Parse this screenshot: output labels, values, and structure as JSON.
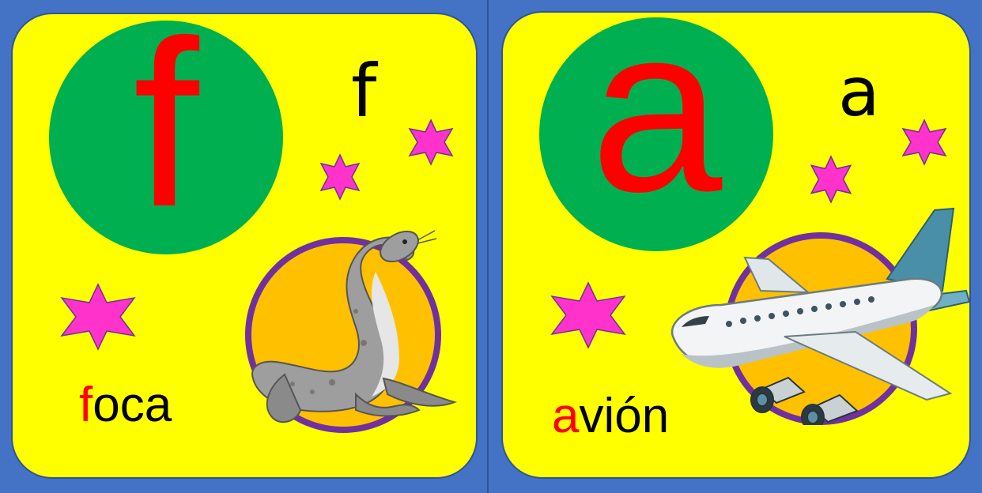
{
  "colors": {
    "background": "#4472c4",
    "card": "#ffff00",
    "circle": "#00b050",
    "big_letter": "#ff0000",
    "star": "#ff33cc",
    "image_circle": "#ffc000",
    "image_ring": "#7030a0"
  },
  "cards": [
    {
      "letter_big": "f",
      "letter_small": "f",
      "word_first": "f",
      "word_rest": "oca",
      "illustration": "seal-illustration"
    },
    {
      "letter_big": "a",
      "letter_small": "a",
      "word_first": "a",
      "word_rest": "vión",
      "illustration": "airplane-illustration"
    }
  ]
}
